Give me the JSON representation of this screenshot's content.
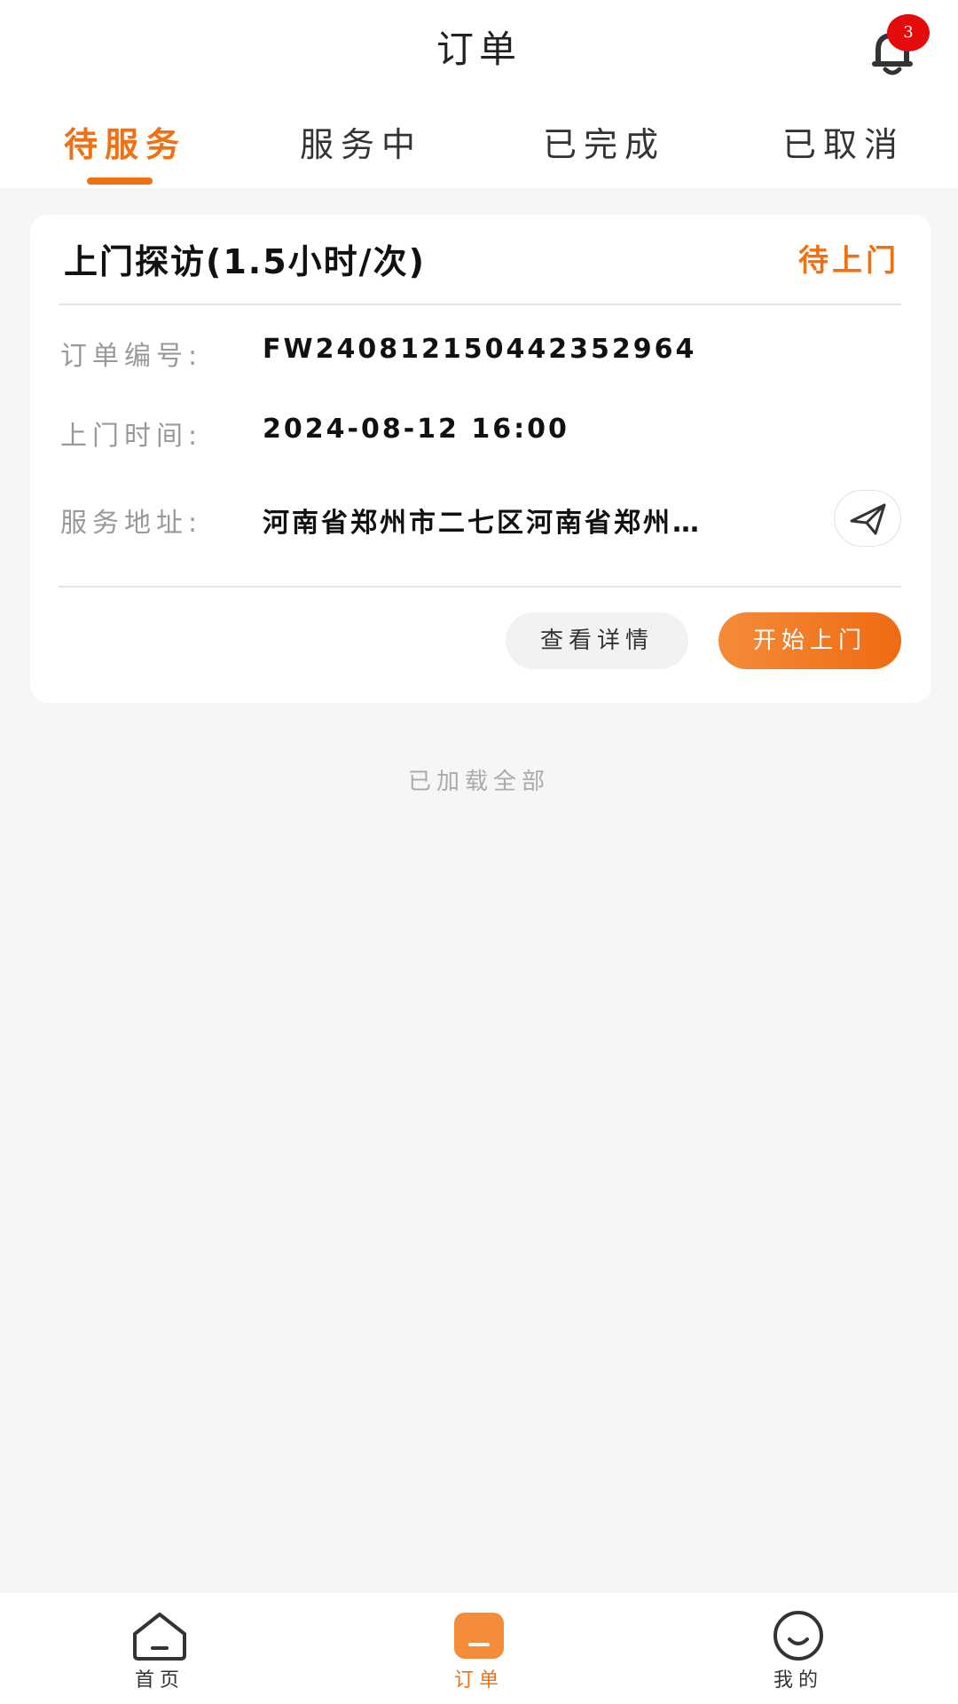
{
  "header": {
    "title": "订单",
    "notification_count": "3"
  },
  "tabs": [
    {
      "label": "待服务",
      "active": true
    },
    {
      "label": "服务中",
      "active": false
    },
    {
      "label": "已完成",
      "active": false
    },
    {
      "label": "已取消",
      "active": false
    }
  ],
  "order": {
    "title": "上门探访(1.5小时/次)",
    "status": "待上门",
    "number_label": "订单编号:",
    "number_value": "FW240812150442352964",
    "time_label": "上门时间:",
    "time_value": "2024-08-12 16:00",
    "address_label": "服务地址:",
    "address_value": "河南省郑州市二七区河南省郑州…",
    "detail_button": "查看详情",
    "start_button": "开始上门"
  },
  "list_footer": "已加载全部",
  "bottom_nav": [
    {
      "label": "首页",
      "icon": "home-icon",
      "active": false
    },
    {
      "label": "订单",
      "icon": "order-icon",
      "active": true
    },
    {
      "label": "我的",
      "icon": "profile-icon",
      "active": false
    }
  ],
  "colors": {
    "accent": "#f07113",
    "badge": "#e30b0b",
    "background": "#f6f6f6"
  }
}
